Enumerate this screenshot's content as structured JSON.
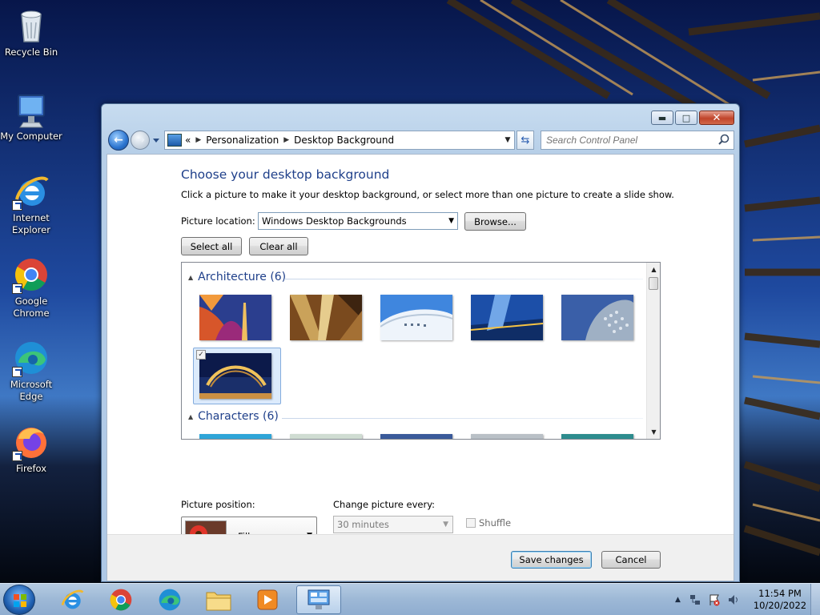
{
  "desktop": {
    "icons": [
      {
        "label_line1": "Recycle Bin",
        "label_line2": ""
      },
      {
        "label_line1": "My Computer",
        "label_line2": ""
      },
      {
        "label_line1": "Internet",
        "label_line2": "Explorer"
      },
      {
        "label_line1": "Google",
        "label_line2": "Chrome"
      },
      {
        "label_line1": "Microsoft",
        "label_line2": "Edge"
      },
      {
        "label_line1": "Firefox",
        "label_line2": ""
      }
    ]
  },
  "window": {
    "address": {
      "overflow": "«",
      "crumbs": [
        "Personalization",
        "Desktop Background"
      ]
    },
    "search": {
      "placeholder": "Search Control Panel"
    },
    "heading": "Choose your desktop background",
    "subtitle": "Click a picture to make it your desktop background, or select more than one picture to create a slide show.",
    "picture_location": {
      "label": "Picture location:",
      "value": "Windows Desktop Backgrounds",
      "browse": "Browse..."
    },
    "select_all": "Select all",
    "clear_all": "Clear all",
    "gallery": {
      "groups": [
        {
          "name": "Architecture (6)",
          "thumb_count": 6,
          "selected_index": 5
        },
        {
          "name": "Characters (6)",
          "thumb_count": 6
        }
      ]
    },
    "picture_position": {
      "label": "Picture position:",
      "value": "Fill"
    },
    "change_picture": {
      "label": "Change picture every:",
      "value": "30 minutes"
    },
    "shuffle": {
      "label": "Shuffle",
      "checked": false
    },
    "save": "Save changes",
    "cancel": "Cancel"
  },
  "taskbar": {
    "clock": {
      "time": "11:54 PM",
      "date": "10/20/2022"
    }
  },
  "colors": {
    "heading_blue": "#1e3f8a",
    "taskbar": "#9db8d6"
  }
}
